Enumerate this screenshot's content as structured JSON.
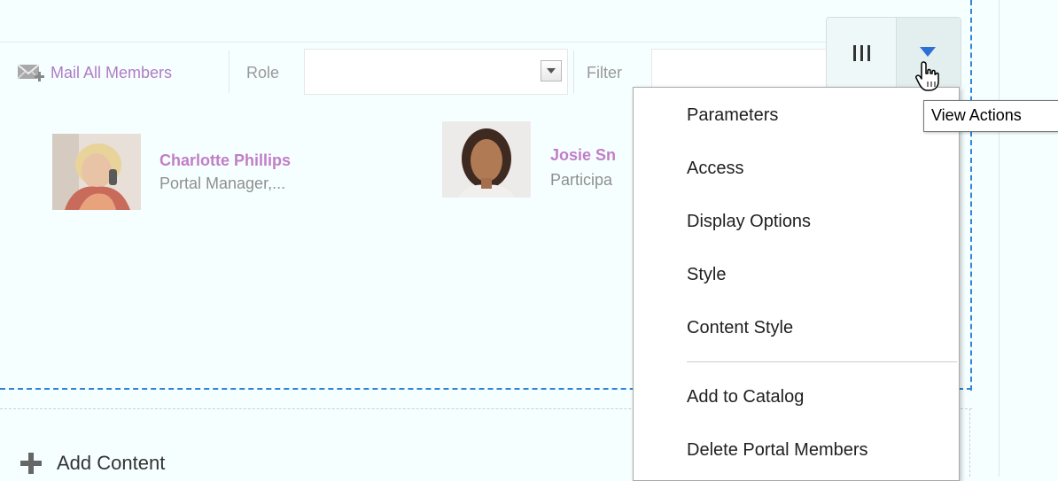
{
  "toolbar": {
    "mail_all_label": "Mail All Members",
    "role_label": "Role",
    "role_value": "",
    "filter_label": "Filter",
    "filter_value": ""
  },
  "members": [
    {
      "name": "Charlotte Phillips",
      "role": "Portal Manager,..."
    },
    {
      "name": "Josie Sn",
      "role": "Participa"
    }
  ],
  "add_content_label": "Add Content",
  "actions": {
    "menu_items": [
      "Parameters",
      "Access",
      "Display Options",
      "Style",
      "Content Style",
      "Add to Catalog",
      "Delete Portal Members"
    ],
    "tooltip": "View Actions"
  },
  "colors": {
    "background": "#f6ffff",
    "link": "#b07cc6",
    "member_name": "#c17ec7",
    "selection_border": "#2f86d8",
    "menu_arrow": "#2c6fd8"
  },
  "icons": [
    "mail-group-icon",
    "select-arrow-icon",
    "grip-icon",
    "down-triangle-icon",
    "hand-cursor-icon",
    "plus-icon"
  ]
}
